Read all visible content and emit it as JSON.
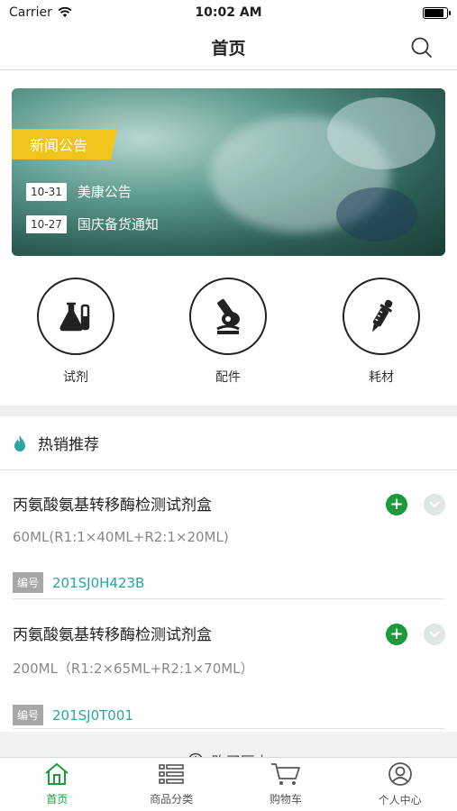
{
  "status_bar": {
    "carrier": "Carrier",
    "time": "10:02 AM",
    "battery_level": 0.9
  },
  "nav": {
    "title": "首页",
    "search_icon": "search-icon"
  },
  "banner": {
    "tag": "新闻公告",
    "news": [
      {
        "date": "10-31",
        "title": "美康公告"
      },
      {
        "date": "10-27",
        "title": "国庆备货通知"
      }
    ]
  },
  "categories": [
    {
      "label": "试剂",
      "icon": "flask-icon"
    },
    {
      "label": "配件",
      "icon": "microscope-icon"
    },
    {
      "label": "耗材",
      "icon": "dropper-icon"
    }
  ],
  "hot": {
    "title": "热销推荐",
    "icon": "flame-icon",
    "accent": "#2aa6a0",
    "products": [
      {
        "name": "丙氨酸氨基转移酶检测试剂盒",
        "spec": "60ML(R1:1×40ML+R2:1×20ML)",
        "code_label": "编号",
        "code": "201SJ0H423B"
      },
      {
        "name": "丙氨酸氨基转移酶检测试剂盒",
        "spec": "200ML（R1:2×65ML+R2:1×70ML）",
        "code_label": "编号",
        "code": "201SJ0T001"
      }
    ]
  },
  "history": {
    "label": "购买历史"
  },
  "tabbar": {
    "active_color": "#1e9a3c",
    "tabs": [
      {
        "label": "首页",
        "icon": "home-icon",
        "active": true
      },
      {
        "label": "商品分类",
        "icon": "list-icon",
        "active": false
      },
      {
        "label": "购物车",
        "icon": "cart-icon",
        "active": false
      },
      {
        "label": "个人中心",
        "icon": "user-icon",
        "active": false
      }
    ]
  }
}
